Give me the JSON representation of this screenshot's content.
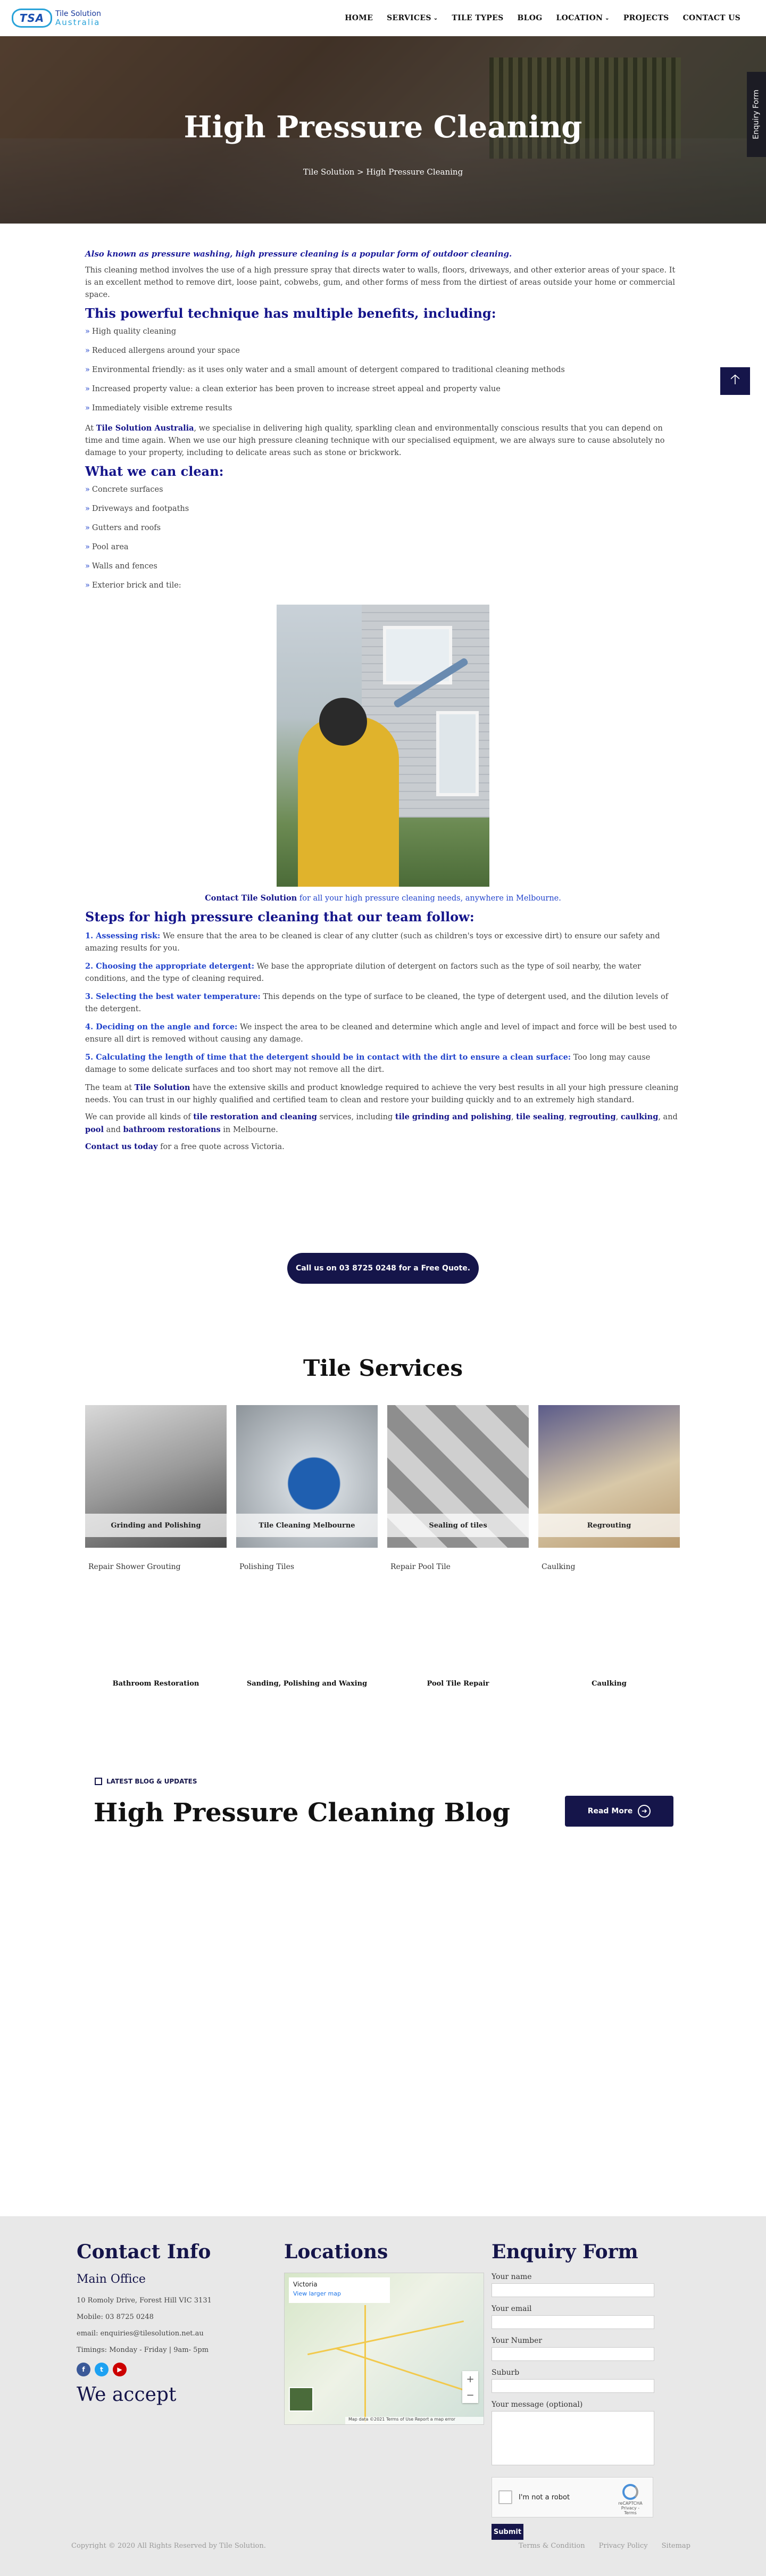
{
  "header": {
    "logo_mark": "TSA",
    "logo_line1": "Tile Solution",
    "logo_line2": "Australia",
    "nav": [
      {
        "label": "HOME"
      },
      {
        "label": "SERVICES",
        "dropdown": true
      },
      {
        "label": "TILE TYPES"
      },
      {
        "label": "BLOG"
      },
      {
        "label": "LOCATION",
        "dropdown": true
      },
      {
        "label": "PROJECTS"
      },
      {
        "label": "CONTACT US"
      }
    ]
  },
  "hero": {
    "title": "High Pressure Cleaning",
    "breadcrumb": "Tile Solution > High Pressure Cleaning"
  },
  "enquiry_tab": "Enquiry Form",
  "back_to_top_icon": "arrow-up-icon",
  "content": {
    "lead": "Also known as pressure washing, high pressure cleaning is a popular form of outdoor cleaning.",
    "intro": "This cleaning method involves the use of a high pressure spray that directs water to walls, floors, driveways, and other exterior areas of your space. It is an excellent method to remove dirt, loose paint, cobwebs, gum, and other forms of mess from the dirtiest of areas outside your home or commercial space.",
    "benefits_heading": "This powerful technique has multiple benefits, including:",
    "benefits": [
      "High quality cleaning",
      "Reduced allergens around your space",
      "Environmental friendly: as it uses only water and a small amount of detergent compared to traditional cleaning methods",
      "Increased property value: a clean exterior has been proven to increase street appeal and property value",
      "Immediately visible extreme results"
    ],
    "about_prefix": "At",
    "about_brand": "Tile Solution Australia",
    "about_text": ", we specialise in delivering high quality, sparkling clean and environmentally conscious results that you can depend on time and time again. When we use our high pressure cleaning technique with our specialised equipment, we are always sure to cause absolutely no damage to your property, including to delicate areas such as stone or brickwork.",
    "clean_heading": "What we can clean:",
    "clean_items": [
      "Concrete surfaces",
      "Driveways and footpaths",
      "Gutters and roofs",
      "Pool area",
      "Walls and fences",
      "Exterior brick and tile:"
    ],
    "caption_bold": "Contact Tile Solution",
    "caption_rest": " for all your high pressure cleaning needs, anywhere in Melbourne.",
    "steps_heading": "Steps for high pressure cleaning that our team follow:",
    "steps": [
      {
        "head": "1. Assessing risk:",
        "text": " We ensure that the area to be cleaned is clear of any clutter (such as children's toys or excessive dirt) to ensure our safety and amazing results for you."
      },
      {
        "head": "2. Choosing the appropriate detergent:",
        "text": " We base the appropriate dilution of detergent on factors such as the type of soil nearby, the water conditions, and the type of cleaning required."
      },
      {
        "head": "3. Selecting the best water temperature:",
        "text": " This depends on the type of surface to be cleaned, the type of detergent used, and the dilution levels of the detergent."
      },
      {
        "head": "4. Deciding on the angle and force:",
        "text": " We inspect the area to be cleaned and determine which angle and level of impact and force will be best used to ensure all dirt is removed without causing any damage."
      },
      {
        "head": "5. Calculating the length of time that the detergent should be in contact with the dirt to ensure a clean surface:",
        "text": " Too long may cause damage to some delicate surfaces and too short may not remove all the dirt."
      }
    ],
    "team_prefix": "The team at",
    "team_brand": "Tile Solution",
    "team_text": " have the extensive skills and product knowledge required to achieve the very best results in all your high pressure cleaning needs. You can trust in our highly qualified and certified team to clean and restore your building quickly and to an extremely high standard.",
    "provide_prefix": "We can provide all kinds of",
    "provide_link1": "tile restoration and cleaning",
    "provide_mid1": " services, including",
    "provide_link2": "tile grinding and polishing",
    "provide_sep1": ",",
    "provide_link3": "tile sealing",
    "provide_sep2": ",",
    "provide_link4": "regrouting",
    "provide_sep3": ",",
    "provide_link5": "caulking",
    "provide_sep4": ", and",
    "provide_link6": "pool",
    "provide_and": " and",
    "provide_link7": "bathroom restorations",
    "provide_end": " in Melbourne.",
    "contact_link": "Contact us today",
    "contact_rest": " for a free quote across Victoria."
  },
  "cta_button": "Call us on 03 8725 0248 for a Free Quote.",
  "services": {
    "title": "Tile Services",
    "cards": [
      {
        "label": "Grinding and Polishing"
      },
      {
        "label": "Tile Cleaning Melbourne"
      },
      {
        "label": "Sealing of tiles"
      },
      {
        "label": "Regrouting"
      }
    ],
    "sub_row1": [
      "Repair Shower Grouting",
      "Polishing Tiles",
      "Repair Pool Tile",
      "Caulking"
    ],
    "sub_row2": [
      "Bathroom Restoration",
      "Sanding, Polishing and Waxing",
      "Pool Tile Repair",
      "Caulking"
    ]
  },
  "blog": {
    "tag": "LATEST BLOG & UPDATES",
    "title": "High Pressure Cleaning Blog",
    "read_more": "Read More"
  },
  "footer": {
    "contact_heading": "Contact Info",
    "office_heading": "Main Office",
    "address": "10 Romoly Drive, Forest Hill VIC 3131",
    "mobile": "Mobile: 03 8725 0248",
    "email": "email: enquiries@tilesolution.net.au",
    "timings": "Timings: Monday - Friday | 9am- 5pm",
    "social": [
      {
        "icon": "facebook-icon",
        "glyph": "f",
        "color": "#3b5998"
      },
      {
        "icon": "twitter-icon",
        "glyph": "t",
        "color": "#1da1f2"
      },
      {
        "icon": "youtube-icon",
        "glyph": "▶",
        "color": "#cc0000"
      }
    ],
    "we_accept": "We accept",
    "locations_heading": "Locations",
    "map_title": "Victoria",
    "map_link": "View larger map",
    "map_footer": "Map data ©2021  Terms of Use  Report a map error",
    "enquiry_heading": "Enquiry Form",
    "fields": [
      "Your name",
      "Your email",
      "Your Number",
      "Suburb"
    ],
    "message_label": "Your message (optional)",
    "captcha_label": "I'm not a robot",
    "captcha_brand": "reCAPTCHA",
    "captcha_terms": "Privacy - Terms",
    "submit": "Submit",
    "copyright": "Copyright © 2020 All Rights Reserved by Tile Solution.",
    "links": [
      "Terms & Condition",
      "Privacy Policy",
      "Sitemap"
    ]
  },
  "colors": {
    "navy": "#15154a",
    "link_blue": "#2244cc",
    "heading_blue": "#14148a",
    "footer_bg": "#e8e8e8"
  }
}
